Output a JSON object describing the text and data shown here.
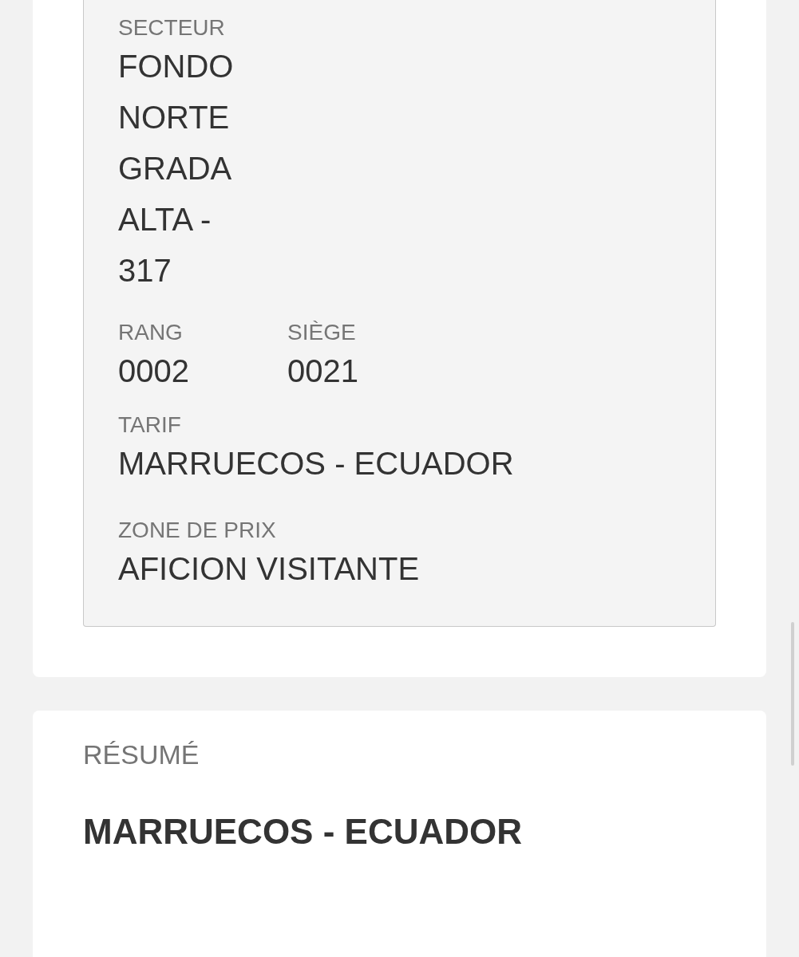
{
  "ticket_details": {
    "sector": {
      "label": "SECTEUR",
      "value": "FONDO NORTE GRADA ALTA - 317"
    },
    "seat": [
      {
        "label": "RANG",
        "value": "0002"
      },
      {
        "label": "SIÈGE",
        "value": "0021"
      }
    ],
    "tariff": {
      "label": "TARIF",
      "value": "MARRUECOS - ECUADOR"
    },
    "price_zone": {
      "label": "ZONE DE PRIX",
      "value": "AFICION VISITANTE"
    }
  },
  "summary": {
    "heading": "RÉSUMÉ",
    "title": "MARRUECOS - ECUADOR"
  }
}
